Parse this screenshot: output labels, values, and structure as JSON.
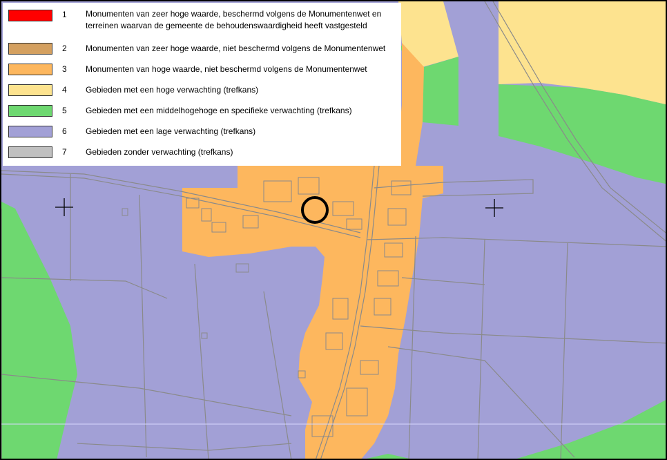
{
  "map": {
    "zones": {
      "monument_protected": "#ff0000",
      "monument_unprotected": "#d4a060",
      "monument_high": "#fdb75e",
      "high_expectation": "#fde38f",
      "medium_expectation": "#6ed870",
      "low_expectation": "#a2a0d6",
      "no_expectation": "#c0c0c0"
    },
    "markers": [
      "crosshair-icon",
      "crosshair-icon",
      "circle-marker"
    ]
  },
  "legend": {
    "items": [
      {
        "num": "1",
        "color": "#ff0000",
        "label": "Monumenten van zeer hoge waarde, beschermd volgens de Monumentenwet en terreinen waarvan de gemeente de behoudenswaardigheid heeft vastgesteld"
      },
      {
        "num": "2",
        "color": "#d4a060",
        "label": "Monumenten van zeer hoge waarde, niet beschermd volgens de Monumentenwet"
      },
      {
        "num": "3",
        "color": "#fdb75e",
        "label": "Monumenten van hoge waarde, niet beschermd volgens de Monumentenwet"
      },
      {
        "num": "4",
        "color": "#fde38f",
        "label": "Gebieden met een hoge verwachting (trefkans)"
      },
      {
        "num": "5",
        "color": "#6ed870",
        "label": "Gebieden met een middelhogehoge en specifieke verwachting (trefkans)"
      },
      {
        "num": "6",
        "color": "#a2a0d6",
        "label": "Gebieden met een lage verwachting (trefkans)"
      },
      {
        "num": "7",
        "color": "#c0c0c0",
        "label": "Gebieden zonder verwachting (trefkans)"
      }
    ]
  }
}
